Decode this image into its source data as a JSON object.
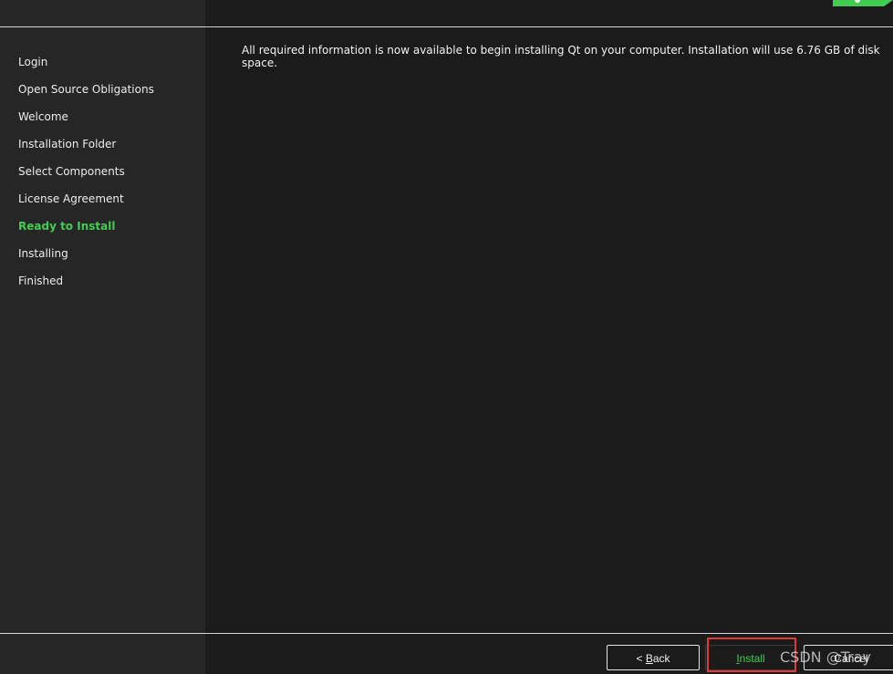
{
  "sidebar": {
    "steps": [
      {
        "label": "Login"
      },
      {
        "label": "Open Source Obligations"
      },
      {
        "label": "Welcome"
      },
      {
        "label": "Installation Folder"
      },
      {
        "label": "Select Components"
      },
      {
        "label": "License Agreement"
      },
      {
        "label": "Ready to Install"
      },
      {
        "label": "Installing"
      },
      {
        "label": "Finished"
      }
    ],
    "active_step": "Ready to Install"
  },
  "main": {
    "message": "All required information is now available to begin installing Qt on your computer. Installation will use 6.76 GB of disk space."
  },
  "footer": {
    "back": {
      "prefix": "< ",
      "mnemonic": "B",
      "rest": "ack"
    },
    "install": {
      "mnemonic": "I",
      "rest": "nstall"
    },
    "cancel": {
      "label": "Cancel"
    }
  },
  "watermark": "CSDN @Tray",
  "colors": {
    "accent": "#41cd52",
    "background": "#1b1b1b",
    "sidebar": "#262626",
    "highlight": "#e23a3a"
  },
  "icons": {
    "logo": "qt-logo-icon"
  }
}
